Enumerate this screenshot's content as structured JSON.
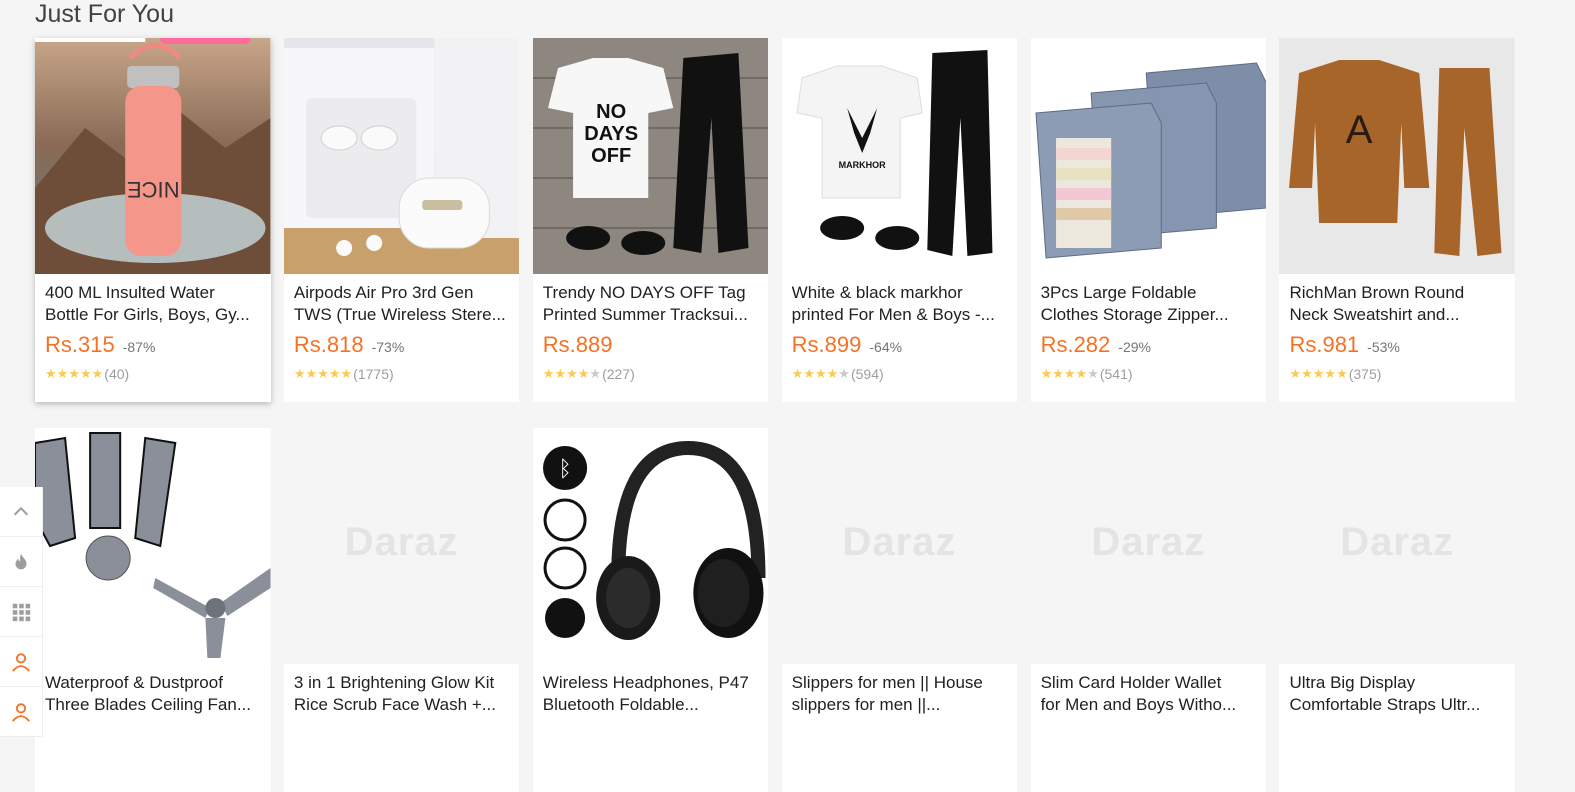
{
  "section": {
    "title": "Just For You"
  },
  "products": [
    {
      "name_line1": "400 ML Insulted Water",
      "name_line2": "Bottle For Girls, Boys, Gy...",
      "price": "Rs.315",
      "discount": "-87%",
      "rating": 4.5,
      "reviews": "(40)",
      "image": "water-bottle-image"
    },
    {
      "name_line1": "Airpods Air Pro 3rd Gen",
      "name_line2": "TWS (True Wireless Stere...",
      "price": "Rs.818",
      "discount": "-73%",
      "rating": 4.5,
      "reviews": "(1775)",
      "image": "airpods-image"
    },
    {
      "name_line1": "Trendy NO DAYS OFF Tag",
      "name_line2": "Printed Summer Tracksui...",
      "price": "Rs.889",
      "discount": "",
      "rating": 4,
      "reviews": "(227)",
      "image": "tracksuit-image"
    },
    {
      "name_line1": "White & black markhor",
      "name_line2": "printed For Men & Boys -...",
      "price": "Rs.899",
      "discount": "-64%",
      "rating": 4,
      "reviews": "(594)",
      "image": "markhor-tracksuit-image"
    },
    {
      "name_line1": "3Pcs Large Foldable",
      "name_line2": "Clothes Storage Zipper...",
      "price": "Rs.282",
      "discount": "-29%",
      "rating": 4,
      "reviews": "(541)",
      "image": "storage-boxes-image"
    },
    {
      "name_line1": "RichMan Brown Round",
      "name_line2": "Neck Sweatshirt and...",
      "price": "Rs.981",
      "discount": "-53%",
      "rating": 4.5,
      "reviews": "(375)",
      "image": "sweatshirt-image"
    },
    {
      "name_line1": "Waterproof & Dustproof",
      "name_line2": "Three Blades Ceiling Fan...",
      "image": "fan-covers-image"
    },
    {
      "name_line1": "3 in 1 Brightening Glow Kit",
      "name_line2": "Rice Scrub Face Wash +...",
      "image": "placeholder",
      "placeholder": "Daraz"
    },
    {
      "name_line1": "Wireless Headphones, P47",
      "name_line2": "Bluetooth Foldable...",
      "image": "headphones-image"
    },
    {
      "name_line1": "Slippers for men || House",
      "name_line2": "slippers for men ||...",
      "image": "placeholder",
      "placeholder": "Daraz"
    },
    {
      "name_line1": "Slim Card Holder Wallet",
      "name_line2": "for Men and Boys Witho...",
      "image": "placeholder",
      "placeholder": "Daraz"
    },
    {
      "name_line1": "Ultra Big Display",
      "name_line2": "Comfortable Straps Ultr...",
      "image": "placeholder",
      "placeholder": "Daraz"
    }
  ],
  "sidebar": [
    "chevron-up-icon",
    "flame-icon",
    "grid-icon",
    "user-icon",
    "user-icon"
  ],
  "colors": {
    "price": "#f57224",
    "star": "#faca51",
    "background": "#f5f5f5"
  }
}
